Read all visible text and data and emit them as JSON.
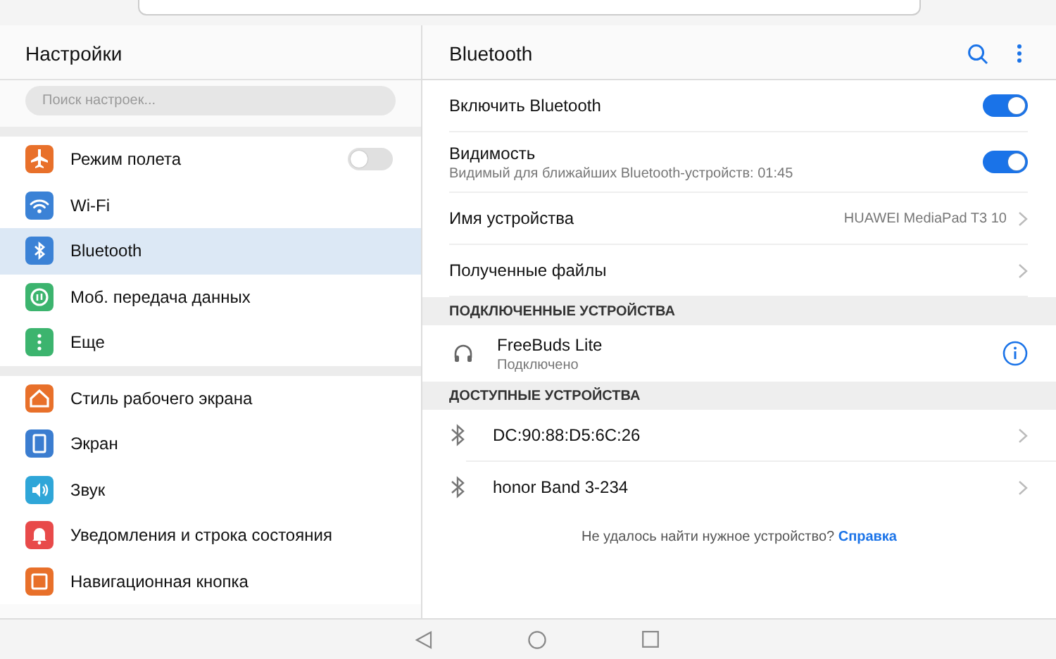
{
  "sidebar": {
    "title": "Настройки",
    "search": {
      "placeholder": "Поиск настроек..."
    },
    "groups": [
      [
        {
          "kind": "toggle",
          "label": "Режим полета",
          "color": "#e8702a",
          "on": false,
          "selected": false
        },
        {
          "kind": "link",
          "label": "Wi-Fi",
          "color": "#3b82d6",
          "selected": false
        },
        {
          "kind": "link",
          "label": "Bluetooth",
          "color": "#3b82d6",
          "selected": true
        },
        {
          "kind": "link",
          "label": "Моб. передача данных",
          "color": "#3cb46e",
          "selected": false
        },
        {
          "kind": "link",
          "label": "Еще",
          "color": "#3cb46e",
          "selected": false
        }
      ],
      [
        {
          "kind": "link",
          "label": "Стиль рабочего экрана",
          "color": "#e8702a",
          "selected": false
        },
        {
          "kind": "link",
          "label": "Экран",
          "color": "#3b7dd0",
          "selected": false
        },
        {
          "kind": "link",
          "label": "Звук",
          "color": "#2fa6d8",
          "selected": false
        },
        {
          "kind": "link",
          "label": "Уведомления и строка состояния",
          "color": "#e84a4a",
          "selected": false
        },
        {
          "kind": "link",
          "label": "Навигационная кнопка",
          "color": "#e8702a",
          "selected": false
        }
      ]
    ]
  },
  "detail": {
    "title": "Bluetooth",
    "settings": [
      {
        "kind": "toggle",
        "label": "Включить Bluetooth",
        "on": true
      },
      {
        "kind": "toggle",
        "label": "Видимость",
        "subtitle": "Видимый для ближайших Bluetooth-устройств: 01:45",
        "on": true
      },
      {
        "kind": "value",
        "label": "Имя устройства",
        "value": "HUAWEI MediaPad T3 10"
      },
      {
        "kind": "link",
        "label": "Полученные файлы"
      }
    ],
    "connected": {
      "header": "ПОДКЛЮЧЕННЫЕ УСТРОЙСТВА",
      "devices": [
        {
          "name": "FreeBuds Lite",
          "status": "Подключено"
        }
      ]
    },
    "available": {
      "header": "ДОСТУПНЫЕ УСТРОЙСТВА",
      "devices": [
        {
          "name": "DC:90:88:D5:6C:26"
        },
        {
          "name": "honor Band 3-234"
        }
      ]
    },
    "help": {
      "text": "Не удалось найти нужное устройство?",
      "link": "Справка"
    }
  }
}
